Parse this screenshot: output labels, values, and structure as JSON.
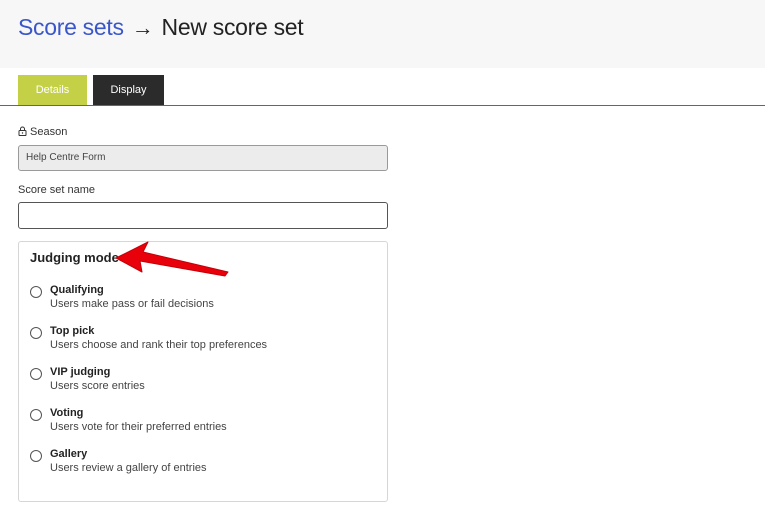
{
  "breadcrumb": {
    "parent": "Score sets",
    "arrow": "→",
    "current": "New score set"
  },
  "tabs": [
    {
      "label": "Details",
      "active": true
    },
    {
      "label": "Display",
      "active": false
    }
  ],
  "season": {
    "label": "Season",
    "value": "Help Centre Form",
    "locked": true
  },
  "score_set_name": {
    "label": "Score set name",
    "value": ""
  },
  "judging_mode": {
    "title": "Judging mode",
    "options": [
      {
        "title": "Qualifying",
        "description": "Users make pass or fail decisions"
      },
      {
        "title": "Top pick",
        "description": "Users choose and rank their top preferences"
      },
      {
        "title": "VIP judging",
        "description": "Users score entries"
      },
      {
        "title": "Voting",
        "description": "Users vote for their preferred entries"
      },
      {
        "title": "Gallery",
        "description": "Users review a gallery of entries"
      }
    ]
  },
  "colors": {
    "link": "#3a57c9",
    "tab_active": "#c4d147",
    "tab_inactive": "#2b2b2b",
    "annotation": "#e8000b"
  },
  "icons": {
    "season_lock": "lock-icon",
    "annotation": "red-arrow-icon"
  }
}
